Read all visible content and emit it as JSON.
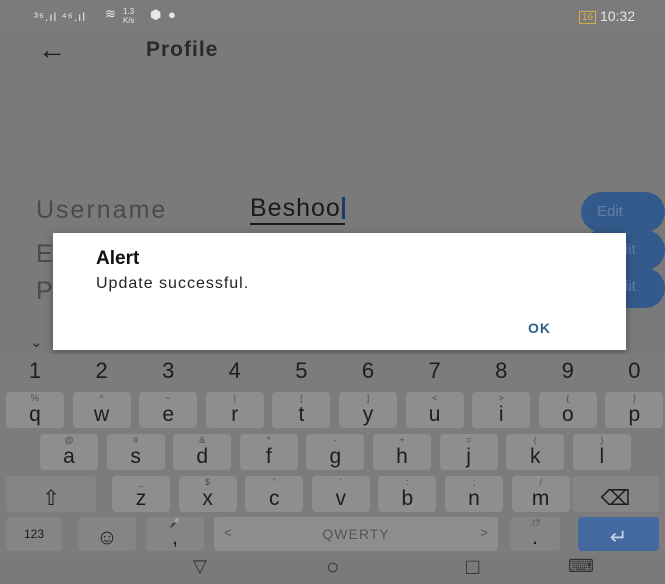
{
  "status_bar": {
    "signal_left": "³⁶.ıl ⁴⁶.ıl",
    "speed": "1.3 K/s",
    "battery": "16",
    "time": "10:32"
  },
  "app_bar": {
    "back_glyph": "←",
    "title": "Profile"
  },
  "profile": {
    "username_label": "Username",
    "username_value": "Beshoo",
    "edit_label": "Edit",
    "email_label_partial": "E",
    "edit_partial": "lit",
    "password_label_partial": "P"
  },
  "dialog": {
    "title": "Alert",
    "message": "Update successful.",
    "ok_label": "OK"
  },
  "keyboard": {
    "numbers": [
      "1",
      "2",
      "3",
      "4",
      "5",
      "6",
      "7",
      "8",
      "9",
      "0"
    ],
    "row1": [
      {
        "c": "q",
        "h": "%"
      },
      {
        "c": "w",
        "h": "^"
      },
      {
        "c": "e",
        "h": "~"
      },
      {
        "c": "r",
        "h": "|"
      },
      {
        "c": "t",
        "h": "["
      },
      {
        "c": "y",
        "h": "]"
      },
      {
        "c": "u",
        "h": "<"
      },
      {
        "c": "i",
        "h": ">"
      },
      {
        "c": "o",
        "h": "{"
      },
      {
        "c": "p",
        "h": "}"
      }
    ],
    "row2": [
      {
        "c": "a",
        "h": "@"
      },
      {
        "c": "s",
        "h": "#"
      },
      {
        "c": "d",
        "h": "&"
      },
      {
        "c": "f",
        "h": "*"
      },
      {
        "c": "g",
        "h": "-"
      },
      {
        "c": "h",
        "h": "+"
      },
      {
        "c": "j",
        "h": "="
      },
      {
        "c": "k",
        "h": "("
      },
      {
        "c": "l",
        "h": ")"
      }
    ],
    "row3": [
      {
        "c": "z",
        "h": "_"
      },
      {
        "c": "x",
        "h": "$"
      },
      {
        "c": "c",
        "h": "\""
      },
      {
        "c": "v",
        "h": "'"
      },
      {
        "c": "b",
        "h": ":"
      },
      {
        "c": "n",
        "h": ";"
      },
      {
        "c": "m",
        "h": "/"
      }
    ],
    "shift_glyph": "⇧",
    "backspace_glyph": "⌫",
    "mode_label": "123",
    "emoji_glyph": "☺",
    "mic_hint": "🎤",
    "comma": ",",
    "space_label": "QWERTY",
    "space_left": "<",
    "space_right": ">",
    "period_hint": ".!?",
    "period": ".",
    "enter_glyph": "↵",
    "collapse_glyph": "⌄"
  },
  "nav_bar": {
    "back": "▽",
    "home": "○",
    "recents": "□",
    "keyboard": "⌨"
  },
  "colors": {
    "dim_background": "#7a7a7a",
    "dialog_background": "#ffffff",
    "accent": "#2f5d8a",
    "edit_button": "#335a8a"
  }
}
